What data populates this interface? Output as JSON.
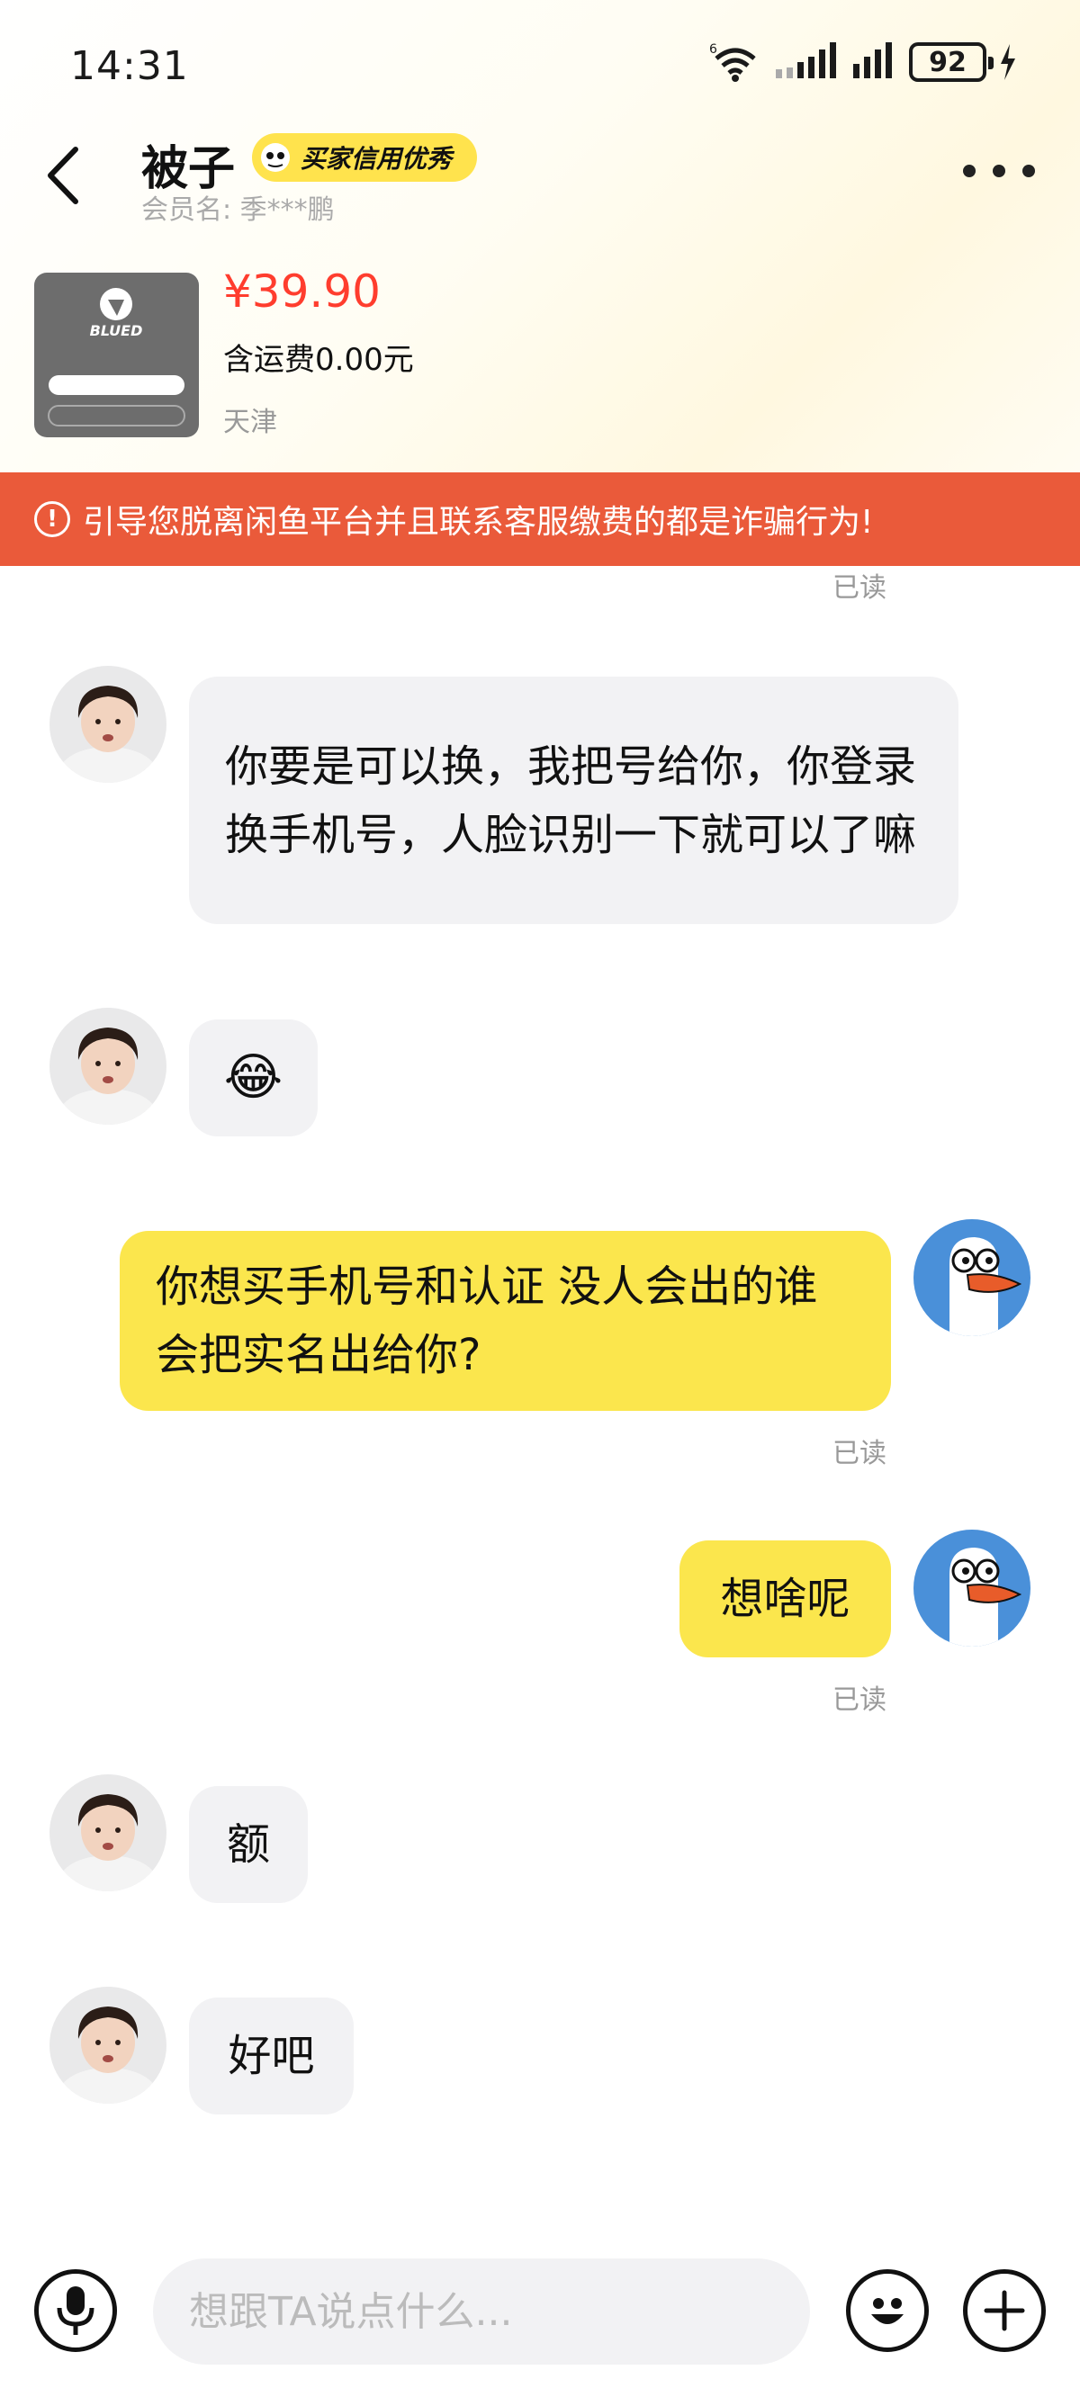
{
  "status_bar": {
    "time": "14:31",
    "battery": "92"
  },
  "header": {
    "name": "被子",
    "credit_badge": "买家信用优秀",
    "member_label": "会员名: 季***鹏"
  },
  "product": {
    "price": "¥39.90",
    "shipping": "含运费0.00元",
    "location": "天津",
    "thumb_brand": "BLUED"
  },
  "warning": {
    "text": "引导您脱离闲鱼平台并且联系客服缴费的都是诈骗行为!"
  },
  "messages": [
    {
      "side": "left",
      "text": "你要是可以换，我把号给你，你登录换手机号，人脸识别一下就可以了嘛"
    },
    {
      "side": "left",
      "text": "😂"
    },
    {
      "side": "right",
      "text": "你想买手机号和认证  没人会出的谁会把实名出给你?",
      "status": "已读"
    },
    {
      "side": "right",
      "text": "想啥呢",
      "status": "已读"
    },
    {
      "side": "left",
      "text": "额"
    },
    {
      "side": "left",
      "text": "好吧"
    }
  ],
  "top_read_label": "已读",
  "input": {
    "placeholder": "想跟TA说点什么..."
  },
  "colors": {
    "accent": "#fbe64d",
    "warning": "#ea5a3a",
    "price": "#ff3d2e"
  }
}
